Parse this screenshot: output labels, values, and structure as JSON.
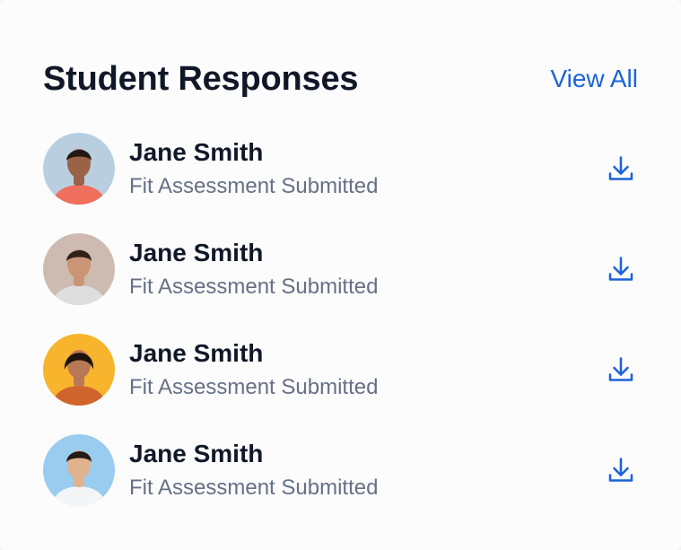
{
  "header": {
    "title": "Student Responses",
    "view_all_label": "View All"
  },
  "responses": [
    {
      "name": "Jane Smith",
      "status": "Fit Assessment Submitted",
      "avatar_bg": "#b9cfe0",
      "avatar_shirt": "#f06f5c",
      "avatar_skin": "#9a6247",
      "avatar_hair": "#24190f",
      "download_icon": "download-icon"
    },
    {
      "name": "Jane Smith",
      "status": "Fit Assessment Submitted",
      "avatar_bg": "#cdbab0",
      "avatar_shirt": "#dedede",
      "avatar_skin": "#c99575",
      "avatar_hair": "#2f2219",
      "download_icon": "download-icon"
    },
    {
      "name": "Jane Smith",
      "status": "Fit Assessment Submitted",
      "avatar_bg": "#f7b42c",
      "avatar_shirt": "#d0642d",
      "avatar_skin": "#b97855",
      "avatar_hair": "#1d120d",
      "download_icon": "download-icon"
    },
    {
      "name": "Jane Smith",
      "status": "Fit Assessment Submitted",
      "avatar_bg": "#99ccef",
      "avatar_shirt": "#f3f6f8",
      "avatar_skin": "#e0b38f",
      "avatar_hair": "#241a16",
      "download_icon": "download-icon"
    }
  ],
  "colors": {
    "accent": "#1d63d8",
    "title": "#101828",
    "secondary_text": "#667085"
  }
}
